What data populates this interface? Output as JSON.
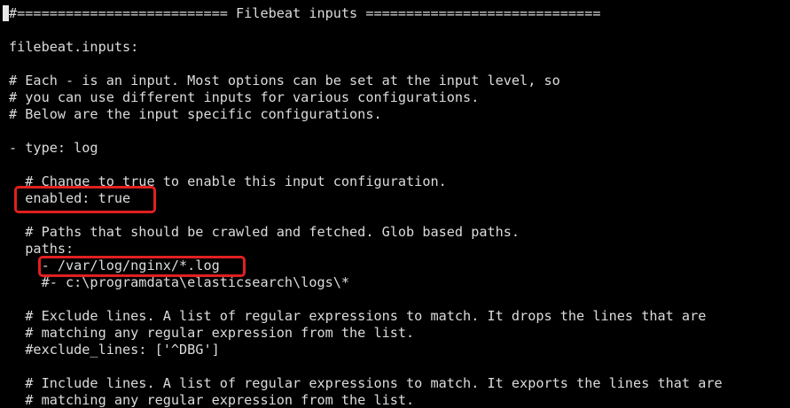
{
  "terminal": {
    "lines": [
      "#========================== Filebeat inputs =============================",
      "",
      "filebeat.inputs:",
      "",
      "# Each - is an input. Most options can be set at the input level, so",
      "# you can use different inputs for various configurations.",
      "# Below are the input specific configurations.",
      "",
      "- type: log",
      "",
      "  # Change to true to enable this input configuration.",
      "  enabled: true",
      "",
      "  # Paths that should be crawled and fetched. Glob based paths.",
      "  paths:",
      "    - /var/log/nginx/*.log",
      "    #- c:\\programdata\\elasticsearch\\logs\\*",
      "",
      "  # Exclude lines. A list of regular expressions to match. It drops the lines that are",
      "  # matching any regular expression from the list.",
      "  #exclude_lines: ['^DBG']",
      "",
      "  # Include lines. A list of regular expressions to match. It exports the lines that are",
      "  # matching any regular expression from the list."
    ]
  },
  "colors": {
    "background": "#000000",
    "text": "#dcdcdc",
    "highlight": "#e0201f"
  }
}
